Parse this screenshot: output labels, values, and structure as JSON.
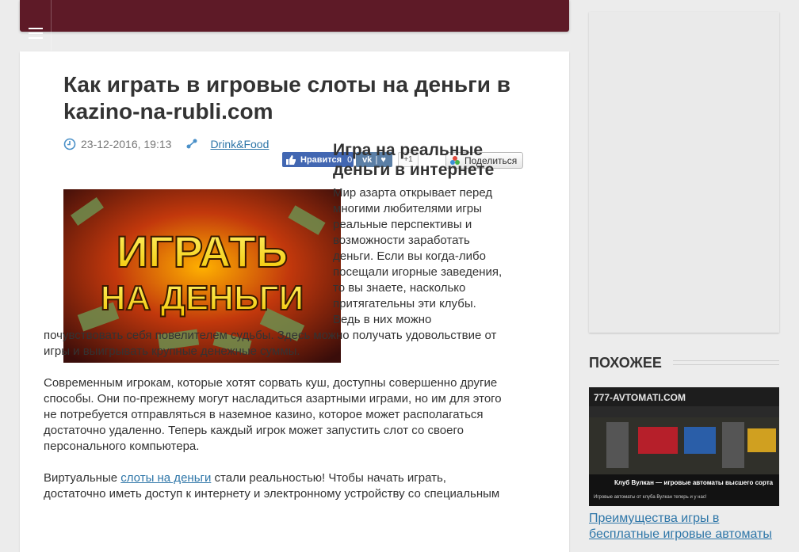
{
  "article": {
    "title": "Как играть в игровые слоты на деньги в kazino-na-rubli.com",
    "date": "23-12-2016, 19:13",
    "category": "Drink&Food",
    "social": {
      "fb_label": "Нравится",
      "fb_count": "0",
      "gplus_label": "+1",
      "share_label": "Поделиться"
    },
    "hero_image_text": [
      "ИГРАТЬ",
      "НА ДЕНЬГИ"
    ],
    "subheading": "Игра на реальные деньги в интернете",
    "paragraph1": "Мир азарта открывает перед многими любителями игры реальные перспективы и возможности заработать деньги. Если вы когда-либо посещали игорные заведения, то вы знаете, насколько притягательны эти клубы. Ведь в них можно почувствовать себя повелителем судьбы. Здесь можно получать удовольствие от игры и выигрывать крупные денежные суммы.",
    "paragraph2": "Современным игрокам, которые хотят сорвать куш, доступны совершенно другие способы. Они по-прежнему могут насладиться азартными играми, но им для этого не потребуется отправляться в наземное казино, которое может располагаться достаточно удаленно. Теперь каждый игрок может запустить слот со своего персонального компьютера.",
    "paragraph3_before_link": "Виртуальные ",
    "paragraph3_link": "слоты на деньги",
    "paragraph3_after_link": " стали реальностью! Чтобы начать играть, достаточно иметь доступ к интернету и электронному устройству со специальным"
  },
  "sidebar": {
    "related_heading": "ПОХОЖЕЕ",
    "related_thumb": {
      "site": "777-AVTOMATI.COM",
      "banner_title": "Клуб Вулкан — игровые автоматы высшего сорта",
      "banner_sub": "Игровые автоматы от клуба Вулкан теперь и у нас!"
    },
    "related_link": "Преимущества игры в бесплатные игровые автоматы"
  },
  "colors": {
    "topbar": "#5e1a27",
    "link": "#2e76a8",
    "background": "#ececec"
  }
}
